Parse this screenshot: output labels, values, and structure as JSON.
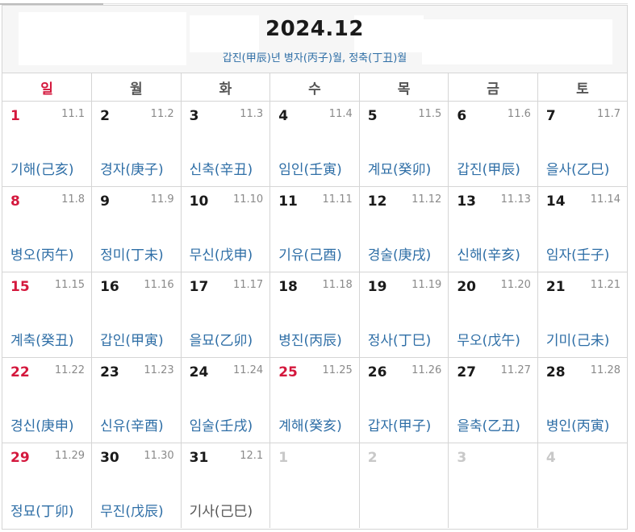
{
  "header": {
    "title": "2024.12",
    "subtitle": "갑진(甲辰)년 병자(丙子)월, 정축(丁丑)월"
  },
  "weekdays": [
    "일",
    "월",
    "화",
    "수",
    "목",
    "금",
    "토"
  ],
  "colors": {
    "sunday": "#d4183d",
    "ganji": "#2e6ea6",
    "muted": "#c8c8c8",
    "lunar": "#8a8a8a"
  },
  "weeks": [
    [
      {
        "day": "1",
        "lunar": "11.1",
        "ganji": "기해(己亥)"
      },
      {
        "day": "2",
        "lunar": "11.2",
        "ganji": "경자(庚子)"
      },
      {
        "day": "3",
        "lunar": "11.3",
        "ganji": "신축(辛丑)"
      },
      {
        "day": "4",
        "lunar": "11.4",
        "ganji": "임인(壬寅)"
      },
      {
        "day": "5",
        "lunar": "11.5",
        "ganji": "계묘(癸卯)"
      },
      {
        "day": "6",
        "lunar": "11.6",
        "ganji": "갑진(甲辰)"
      },
      {
        "day": "7",
        "lunar": "11.7",
        "ganji": "을사(乙巳)"
      }
    ],
    [
      {
        "day": "8",
        "lunar": "11.8",
        "ganji": "병오(丙午)"
      },
      {
        "day": "9",
        "lunar": "11.9",
        "ganji": "정미(丁未)"
      },
      {
        "day": "10",
        "lunar": "11.10",
        "ganji": "무신(戊申)"
      },
      {
        "day": "11",
        "lunar": "11.11",
        "ganji": "기유(己酉)"
      },
      {
        "day": "12",
        "lunar": "11.12",
        "ganji": "경술(庚戌)"
      },
      {
        "day": "13",
        "lunar": "11.13",
        "ganji": "신해(辛亥)"
      },
      {
        "day": "14",
        "lunar": "11.14",
        "ganji": "임자(壬子)"
      }
    ],
    [
      {
        "day": "15",
        "lunar": "11.15",
        "ganji": "계축(癸丑)"
      },
      {
        "day": "16",
        "lunar": "11.16",
        "ganji": "갑인(甲寅)"
      },
      {
        "day": "17",
        "lunar": "11.17",
        "ganji": "을묘(乙卯)"
      },
      {
        "day": "18",
        "lunar": "11.18",
        "ganji": "병진(丙辰)"
      },
      {
        "day": "19",
        "lunar": "11.19",
        "ganji": "정사(丁巳)"
      },
      {
        "day": "20",
        "lunar": "11.20",
        "ganji": "무오(戊午)"
      },
      {
        "day": "21",
        "lunar": "11.21",
        "ganji": "기미(己未)"
      }
    ],
    [
      {
        "day": "22",
        "lunar": "11.22",
        "ganji": "경신(庚申)"
      },
      {
        "day": "23",
        "lunar": "11.23",
        "ganji": "신유(辛酉)"
      },
      {
        "day": "24",
        "lunar": "11.24",
        "ganji": "임술(壬戌)"
      },
      {
        "day": "25",
        "lunar": "11.25",
        "ganji": "계해(癸亥)"
      },
      {
        "day": "26",
        "lunar": "11.26",
        "ganji": "갑자(甲子)"
      },
      {
        "day": "27",
        "lunar": "11.27",
        "ganji": "을축(乙丑)"
      },
      {
        "day": "28",
        "lunar": "11.28",
        "ganji": "병인(丙寅)"
      }
    ],
    [
      {
        "day": "29",
        "lunar": "11.29",
        "ganji": "정묘(丁卯)"
      },
      {
        "day": "30",
        "lunar": "11.30",
        "ganji": "무진(戊辰)"
      },
      {
        "day": "31",
        "lunar": "12.1",
        "ganji": "기사(己巳)"
      },
      {
        "day": "1"
      },
      {
        "day": "2"
      },
      {
        "day": "3"
      },
      {
        "day": "4"
      }
    ]
  ]
}
